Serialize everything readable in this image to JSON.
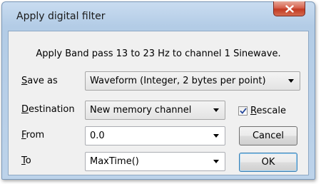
{
  "window": {
    "title": "Apply digital filter",
    "close_icon": "close-x-icon"
  },
  "message": "Apply Band pass 13 to 23 Hz to channel 1 Sinewave.",
  "fields": {
    "save_as": {
      "label_mnemonic": "S",
      "label_rest": "ave as",
      "value": "Waveform (Integer, 2 bytes per point)"
    },
    "destination": {
      "label_mnemonic": "D",
      "label_rest": "estination",
      "value": "New memory channel"
    },
    "from": {
      "label_mnemonic": "F",
      "label_rest": "rom",
      "value": "0.0"
    },
    "to": {
      "label_mnemonic": "T",
      "label_rest": "o",
      "value": "MaxTime()"
    }
  },
  "rescale": {
    "label_mnemonic": "R",
    "label_rest": "escale",
    "checked": true
  },
  "buttons": {
    "cancel": "Cancel",
    "ok": "OK"
  }
}
